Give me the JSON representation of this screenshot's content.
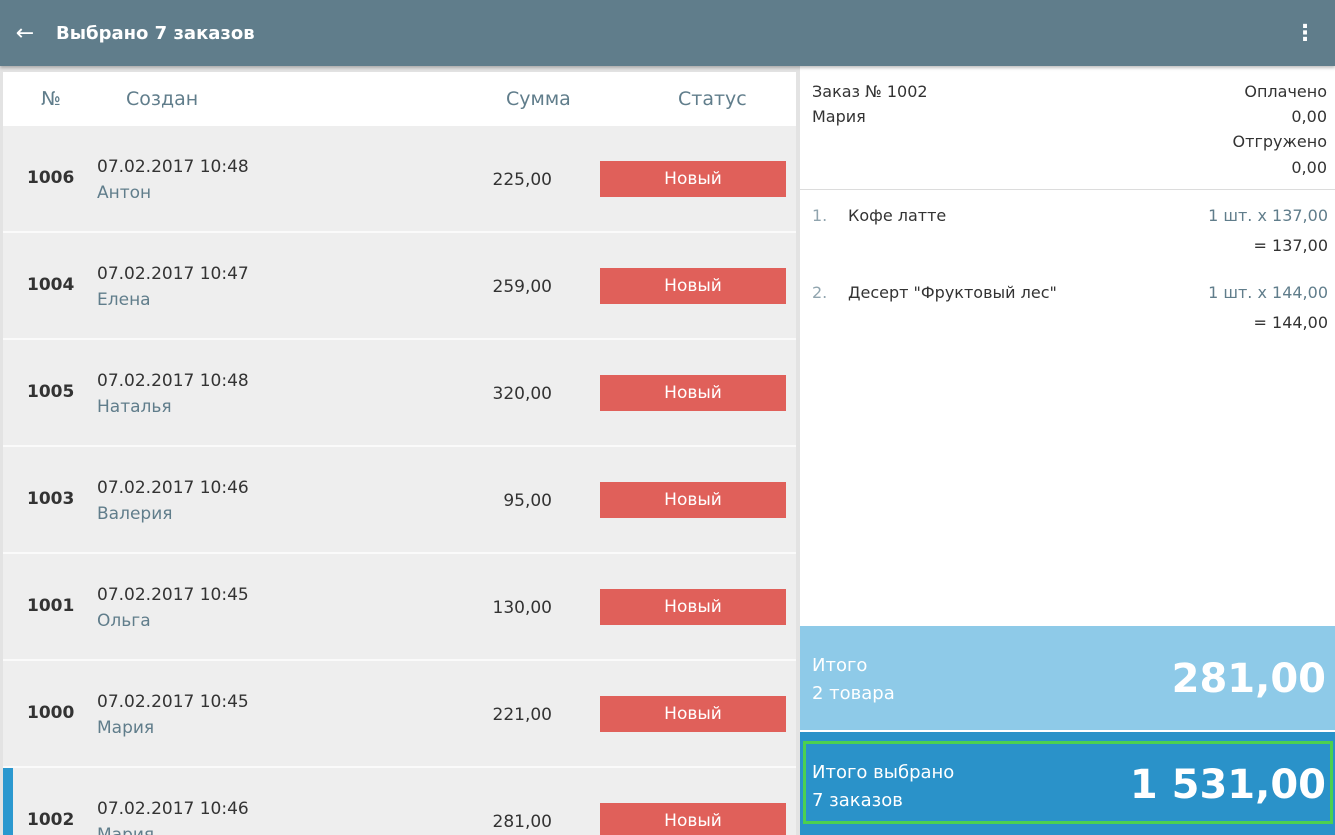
{
  "appbar": {
    "title": "Выбрано 7 заказов",
    "back_icon": "←",
    "menu_icon": "⋮"
  },
  "table": {
    "headers": {
      "num": "№",
      "created": "Создан",
      "sum": "Сумма",
      "status": "Статус"
    },
    "rows": [
      {
        "num": "1006",
        "date": "07.02.2017 10:48",
        "name": "Антон",
        "sum": "225,00",
        "status": "Новый"
      },
      {
        "num": "1004",
        "date": "07.02.2017 10:47",
        "name": "Елена",
        "sum": "259,00",
        "status": "Новый"
      },
      {
        "num": "1005",
        "date": "07.02.2017 10:48",
        "name": "Наталья",
        "sum": "320,00",
        "status": "Новый"
      },
      {
        "num": "1003",
        "date": "07.02.2017 10:46",
        "name": "Валерия",
        "sum": "95,00",
        "status": "Новый"
      },
      {
        "num": "1001",
        "date": "07.02.2017 10:45",
        "name": "Ольга",
        "sum": "130,00",
        "status": "Новый"
      },
      {
        "num": "1000",
        "date": "07.02.2017 10:45",
        "name": "Мария",
        "sum": "221,00",
        "status": "Новый"
      },
      {
        "num": "1002",
        "date": "07.02.2017 10:46",
        "name": "Мария",
        "sum": "281,00",
        "status": "Новый"
      }
    ]
  },
  "order": {
    "title": "Заказ № 1002",
    "customer": "Мария",
    "paid_label": "Оплачено",
    "paid_value": "0,00",
    "shipped_label": "Отгружено",
    "shipped_value": "0,00",
    "items": [
      {
        "idx": "1.",
        "name": "Кофе латте",
        "qty": "1 шт. х 137,00",
        "total": "= 137,00"
      },
      {
        "idx": "2.",
        "name": "Десерт \"Фруктовый лес\"",
        "qty": "1 шт. х 144,00",
        "total": "= 144,00"
      }
    ]
  },
  "total": {
    "label": "Итого",
    "count": "2 товара",
    "value": "281,00"
  },
  "grand_total": {
    "label": "Итого выбрано",
    "count": "7 заказов",
    "value": "1 531,00"
  },
  "colors": {
    "appbar": "#607d8b",
    "status_new": "#e0605a",
    "total": "#8ecae8",
    "grand_total": "#2a92c9",
    "highlight": "#4cd04f"
  }
}
